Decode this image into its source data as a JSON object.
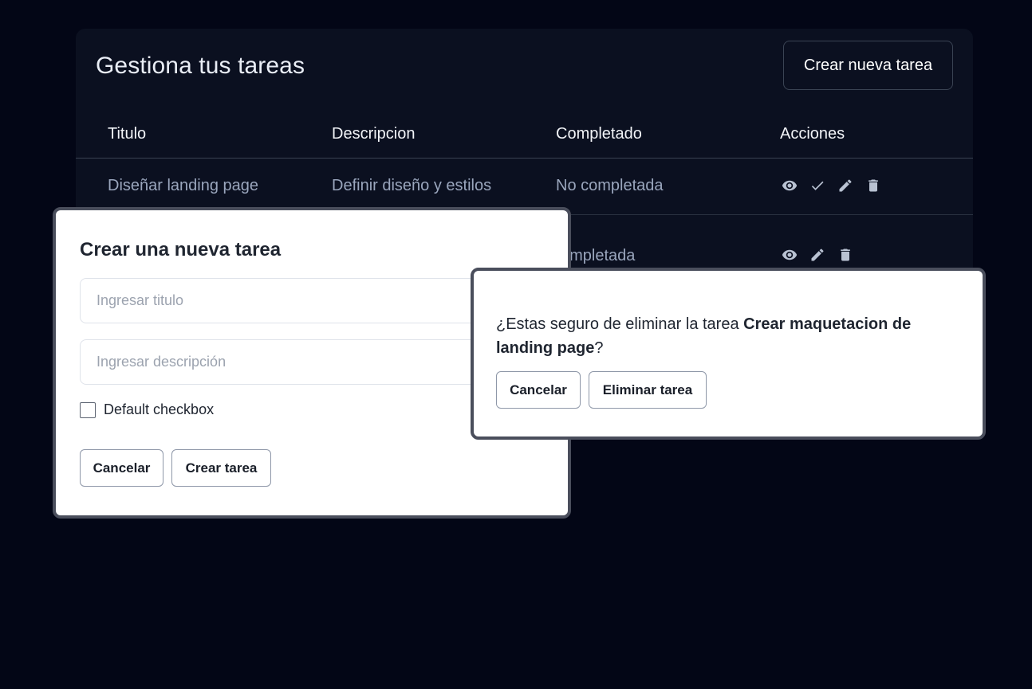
{
  "page": {
    "title": "Gestiona tus tareas",
    "new_task_button": "Crear nueva tarea"
  },
  "table": {
    "headers": [
      "Titulo",
      "Descripcion",
      "Completado",
      "Acciones"
    ],
    "rows": [
      {
        "title": "Diseñar landing page",
        "description": "Definir diseño y estilos",
        "status": "No completada",
        "actions": [
          "eye-icon",
          "check-icon",
          "pencil-icon",
          "trash-icon"
        ]
      },
      {
        "title": "",
        "description": "",
        "status": "Completada",
        "status_visible": "ompletada",
        "actions": [
          "eye-icon",
          "pencil-icon",
          "trash-icon"
        ]
      }
    ]
  },
  "create_modal": {
    "title": "Crear una nueva tarea",
    "title_placeholder": "Ingresar titulo",
    "description_placeholder": "Ingresar descripción",
    "checkbox_label": "Default checkbox",
    "cancel_label": "Cancelar",
    "submit_label": "Crear tarea"
  },
  "delete_modal": {
    "text_prefix": "¿Estas seguro de eliminar la tarea ",
    "task_name": "Crear maquetacion de landing page",
    "text_suffix": "?",
    "cancel_label": "Cancelar",
    "delete_label": "Eliminar tarea"
  },
  "colors": {
    "background": "#030616",
    "card": "#0b1020",
    "muted_text": "#9aa6bd",
    "icon": "#b9c2d2",
    "modal_border": "#4a4e5c"
  }
}
